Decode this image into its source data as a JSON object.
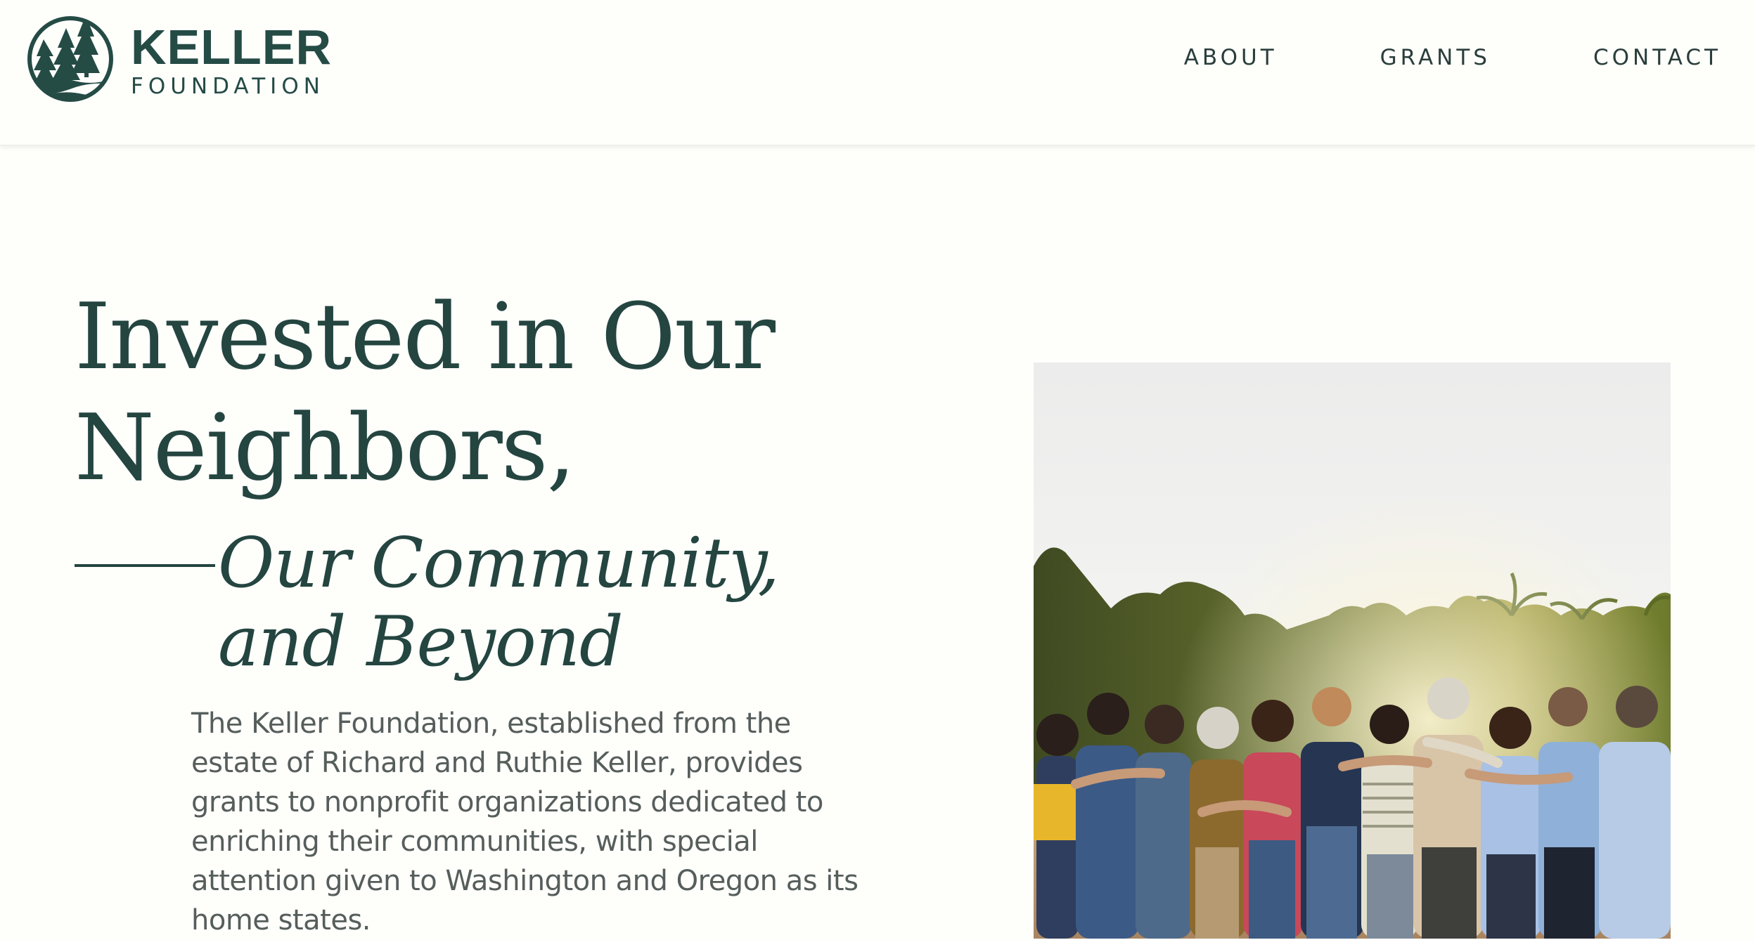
{
  "header": {
    "logo": {
      "name": "KELLER",
      "subtitle": "FOUNDATION"
    },
    "nav": [
      {
        "label": "ABOUT"
      },
      {
        "label": "GRANTS"
      },
      {
        "label": "CONTACT"
      }
    ]
  },
  "hero": {
    "title": "Invested in Our Neighbors,",
    "subtitle": "Our Community, and Beyond",
    "body": "The Keller Foundation, established from the estate of Richard and Ruthie Keller, provides grants to nonprofit organizations dedicated to enriching their communities, with special attention given to Washington and Oregon as its home states."
  },
  "colors": {
    "brand": "#244540",
    "background": "#fefefb",
    "body_text": "#565e5c"
  },
  "icons": {
    "logo_mark": "trees-over-waves-icon"
  }
}
